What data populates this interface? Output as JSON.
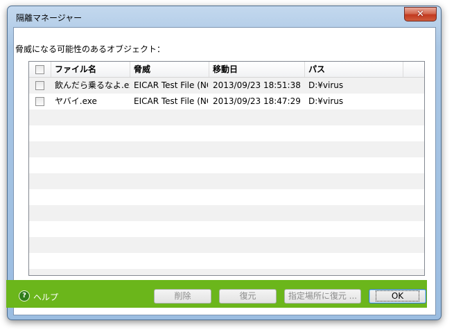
{
  "window": {
    "title": "隔離マネージャー",
    "close_glyph": "✕"
  },
  "prompt": "脅威になる可能性のあるオブジェクト：",
  "columns": [
    "ファイル名",
    "脅威",
    "移動日",
    "パス"
  ],
  "rows": [
    {
      "name": "飲んだら乗るなよ.exe",
      "threat": "EICAR Test File (NOT a Virus!)",
      "date": "2013/09/23 18:51:38",
      "path": "D:¥virus"
    },
    {
      "name": "ヤバイ.exe",
      "threat": "EICAR Test File (NOT a Virus!)",
      "date": "2013/09/23 18:47:29",
      "path": "D:¥virus"
    }
  ],
  "footer": {
    "help_label": "ヘルプ",
    "help_glyph": "?",
    "buttons": {
      "delete": "削除",
      "restore": "復元",
      "restore_to": "指定場所に復元 ...",
      "ok": "OK"
    }
  },
  "colors": {
    "footer_bg": "#6bb61b",
    "title_bar": "#a9c6e4",
    "close_button": "#c2391f"
  }
}
